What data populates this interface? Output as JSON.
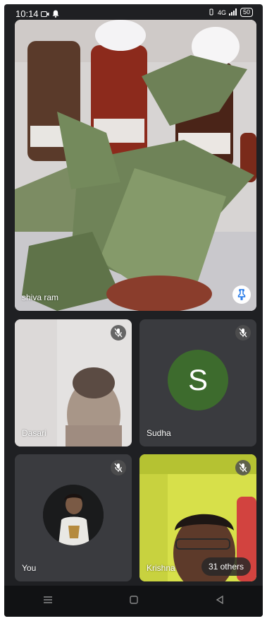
{
  "status_bar": {
    "time": "10:14",
    "network": "4G",
    "battery": "50"
  },
  "participants": {
    "main": {
      "name": "shiva ram"
    },
    "dasari": {
      "name": "Dasari"
    },
    "sudha": {
      "name": "Sudha",
      "initial": "S"
    },
    "you": {
      "name": "You"
    },
    "krishna": {
      "name": "Krishna"
    }
  },
  "others_label": "31 others",
  "colors": {
    "sudha_avatar": "#3d6b2d",
    "pin_accent": "#1a73e8",
    "background": "#1f2023"
  }
}
